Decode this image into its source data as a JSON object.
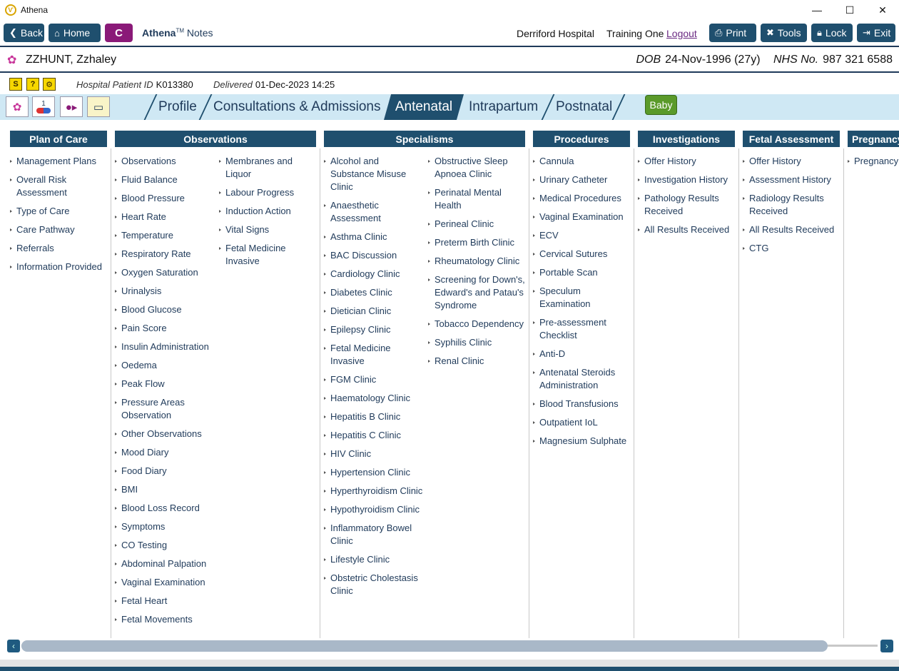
{
  "window": {
    "title": "Athena",
    "logo_glyph": "Ѵ",
    "controls": [
      "—",
      "☐",
      "✕"
    ]
  },
  "toolbar": {
    "back": "Back",
    "home": "Home",
    "c_label": "C",
    "brand_bold": "Athena",
    "brand_tm": "TM",
    "brand_rest": "Notes",
    "hospital": "Derriford Hospital",
    "user": "Training One",
    "logout": "Logout",
    "print": "Print",
    "tools": "Tools",
    "lock": "Lock",
    "exit": "Exit"
  },
  "patient": {
    "name": "ZZHUNT, Zzhaley",
    "dob_label": "DOB",
    "dob_value": "24-Nov-1996 (27y)",
    "nhs_label": "NHS No.",
    "nhs_value": "987 321 6588"
  },
  "info": {
    "hosp_id_label": "Hospital Patient ID",
    "hosp_id_value": "K013380",
    "delivered_label": "Delivered",
    "delivered_value": "01-Dec-2023 14:25",
    "mini_icons": [
      "S",
      "?",
      "⚙"
    ]
  },
  "tabs": [
    "Profile",
    "Consultations & Admissions",
    "Antenatal",
    "Intrapartum",
    "Postnatal"
  ],
  "active_tab": "Antenatal",
  "baby_button": "Baby",
  "tool_icons": {
    "t2_badge": "1"
  },
  "columns": {
    "plan_of_care": {
      "title": "Plan of Care",
      "items": [
        "Management Plans",
        "Overall Risk Assessment",
        "Type of Care",
        "Care Pathway",
        "Referrals",
        "Information Provided"
      ]
    },
    "observations": {
      "title": "Observations",
      "items_a": [
        "Observations",
        "Fluid Balance",
        "Blood Pressure",
        "Heart Rate",
        "Temperature",
        "Respiratory Rate",
        "Oxygen Saturation",
        "Urinalysis",
        "Blood Glucose",
        "Pain Score",
        "Insulin Administration",
        "Oedema",
        "Peak Flow",
        "Pressure Areas Observation",
        "Other Observations",
        "Mood Diary",
        "Food Diary",
        "BMI",
        "Blood Loss Record",
        "Symptoms",
        "CO Testing",
        "Abdominal Palpation",
        "Vaginal Examination",
        "Fetal Heart",
        "Fetal Movements"
      ],
      "items_b": [
        "Membranes and Liquor",
        "Labour Progress",
        "Induction Action",
        "Vital Signs",
        "Fetal Medicine Invasive"
      ]
    },
    "specialisms": {
      "title": "Specialisms",
      "items_a": [
        "Alcohol and Substance Misuse Clinic",
        "Anaesthetic Assessment",
        "Asthma Clinic",
        "BAC Discussion",
        "Cardiology Clinic",
        "Diabetes Clinic",
        "Dietician Clinic",
        "Epilepsy Clinic",
        "Fetal Medicine Invasive",
        "FGM Clinic",
        "Haematology Clinic",
        "Hepatitis B Clinic",
        "Hepatitis C Clinic",
        "HIV Clinic",
        "Hypertension Clinic",
        "Hyperthyroidism Clinic",
        "Hypothyroidism Clinic",
        "Inflammatory Bowel Clinic",
        "Lifestyle Clinic",
        "Obstetric Cholestasis Clinic"
      ],
      "items_b": [
        "Obstructive Sleep Apnoea Clinic",
        "Perinatal Mental Health",
        "Perineal Clinic",
        "Preterm Birth Clinic",
        "Rheumatology Clinic",
        "Screening for Down's, Edward's and Patau's Syndrome",
        "Tobacco Dependency",
        "Syphilis Clinic",
        "Renal Clinic"
      ]
    },
    "procedures": {
      "title": "Procedures",
      "items": [
        "Cannula",
        "Urinary Catheter",
        "Medical Procedures",
        "Vaginal Examination",
        "ECV",
        "Cervical Sutures",
        "Portable Scan",
        "Speculum Examination",
        "Pre-assessment Checklist",
        "Anti-D",
        "Antenatal Steroids Administration",
        "Blood Transfusions",
        "Outpatient IoL",
        "Magnesium Sulphate"
      ]
    },
    "investigations": {
      "title": "Investigations",
      "items": [
        "Offer History",
        "Investigation History",
        "Pathology Results Received",
        "All Results Received"
      ]
    },
    "fetal_assessment": {
      "title": "Fetal Assessment",
      "items": [
        "Offer History",
        "Assessment History",
        "Radiology Results Received",
        "All Results Received",
        "CTG"
      ]
    },
    "pregnancy": {
      "title": "Pregnancy",
      "items": [
        "Pregnancy"
      ]
    }
  },
  "scroll": {
    "left": "‹",
    "right": "›"
  }
}
